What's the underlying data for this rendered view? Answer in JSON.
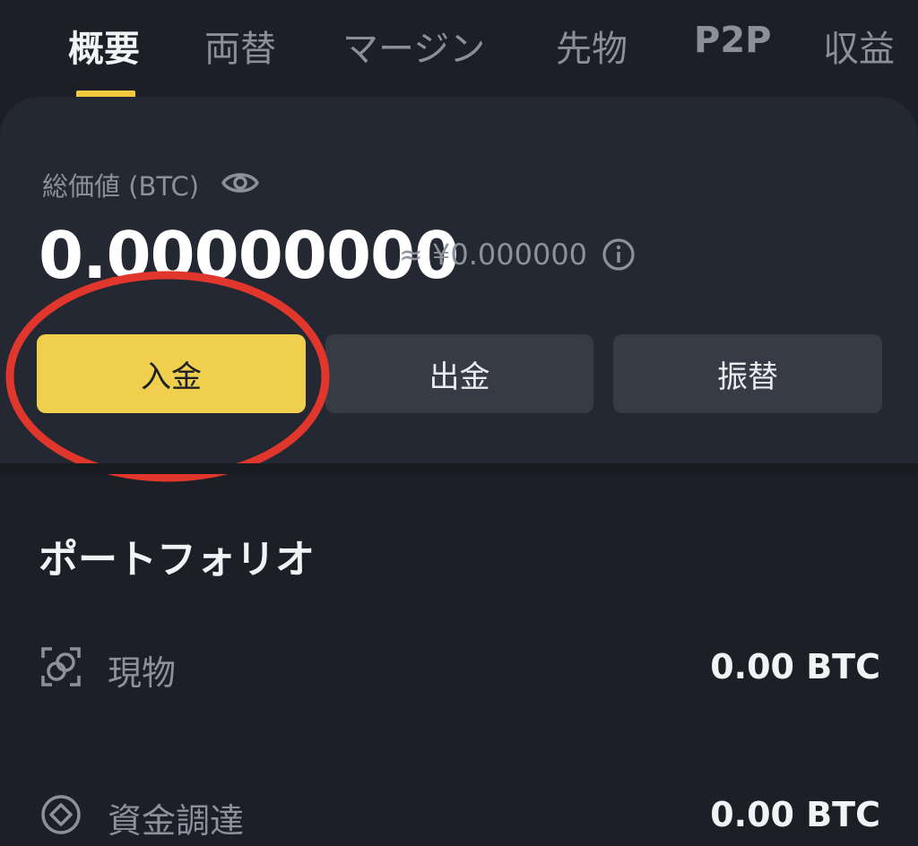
{
  "tabs": [
    {
      "label": "概要"
    },
    {
      "label": "両替"
    },
    {
      "label": "マージン"
    },
    {
      "label": "先物"
    },
    {
      "label": "P2P"
    },
    {
      "label": "収益"
    }
  ],
  "summary": {
    "total_label": "総価値 (BTC)",
    "balance": "0.00000000",
    "approx_value": "≈ ¥0.000000"
  },
  "actions": {
    "deposit": "入金",
    "withdraw": "出金",
    "transfer": "振替"
  },
  "portfolio": {
    "title": "ポートフォリオ",
    "rows": [
      {
        "label": "現物",
        "value": "0.00 BTC",
        "icon": "spot-icon"
      },
      {
        "label": "資金調達",
        "value": "0.00 BTC",
        "icon": "funding-icon"
      }
    ]
  },
  "colors": {
    "accent": "#f0cf4e",
    "background": "#1c1f26",
    "card": "#242832",
    "highlight": "#e0362c"
  }
}
